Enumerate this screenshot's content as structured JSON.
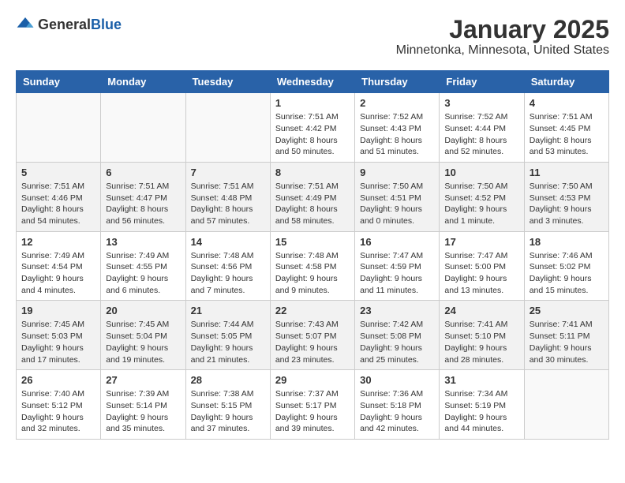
{
  "header": {
    "logo_general": "General",
    "logo_blue": "Blue",
    "month": "January 2025",
    "location": "Minnetonka, Minnesota, United States"
  },
  "days_of_week": [
    "Sunday",
    "Monday",
    "Tuesday",
    "Wednesday",
    "Thursday",
    "Friday",
    "Saturday"
  ],
  "weeks": [
    {
      "shade": false,
      "days": [
        {
          "num": "",
          "info": ""
        },
        {
          "num": "",
          "info": ""
        },
        {
          "num": "",
          "info": ""
        },
        {
          "num": "1",
          "info": "Sunrise: 7:51 AM\nSunset: 4:42 PM\nDaylight: 8 hours\nand 50 minutes."
        },
        {
          "num": "2",
          "info": "Sunrise: 7:52 AM\nSunset: 4:43 PM\nDaylight: 8 hours\nand 51 minutes."
        },
        {
          "num": "3",
          "info": "Sunrise: 7:52 AM\nSunset: 4:44 PM\nDaylight: 8 hours\nand 52 minutes."
        },
        {
          "num": "4",
          "info": "Sunrise: 7:51 AM\nSunset: 4:45 PM\nDaylight: 8 hours\nand 53 minutes."
        }
      ]
    },
    {
      "shade": true,
      "days": [
        {
          "num": "5",
          "info": "Sunrise: 7:51 AM\nSunset: 4:46 PM\nDaylight: 8 hours\nand 54 minutes."
        },
        {
          "num": "6",
          "info": "Sunrise: 7:51 AM\nSunset: 4:47 PM\nDaylight: 8 hours\nand 56 minutes."
        },
        {
          "num": "7",
          "info": "Sunrise: 7:51 AM\nSunset: 4:48 PM\nDaylight: 8 hours\nand 57 minutes."
        },
        {
          "num": "8",
          "info": "Sunrise: 7:51 AM\nSunset: 4:49 PM\nDaylight: 8 hours\nand 58 minutes."
        },
        {
          "num": "9",
          "info": "Sunrise: 7:50 AM\nSunset: 4:51 PM\nDaylight: 9 hours\nand 0 minutes."
        },
        {
          "num": "10",
          "info": "Sunrise: 7:50 AM\nSunset: 4:52 PM\nDaylight: 9 hours\nand 1 minute."
        },
        {
          "num": "11",
          "info": "Sunrise: 7:50 AM\nSunset: 4:53 PM\nDaylight: 9 hours\nand 3 minutes."
        }
      ]
    },
    {
      "shade": false,
      "days": [
        {
          "num": "12",
          "info": "Sunrise: 7:49 AM\nSunset: 4:54 PM\nDaylight: 9 hours\nand 4 minutes."
        },
        {
          "num": "13",
          "info": "Sunrise: 7:49 AM\nSunset: 4:55 PM\nDaylight: 9 hours\nand 6 minutes."
        },
        {
          "num": "14",
          "info": "Sunrise: 7:48 AM\nSunset: 4:56 PM\nDaylight: 9 hours\nand 7 minutes."
        },
        {
          "num": "15",
          "info": "Sunrise: 7:48 AM\nSunset: 4:58 PM\nDaylight: 9 hours\nand 9 minutes."
        },
        {
          "num": "16",
          "info": "Sunrise: 7:47 AM\nSunset: 4:59 PM\nDaylight: 9 hours\nand 11 minutes."
        },
        {
          "num": "17",
          "info": "Sunrise: 7:47 AM\nSunset: 5:00 PM\nDaylight: 9 hours\nand 13 minutes."
        },
        {
          "num": "18",
          "info": "Sunrise: 7:46 AM\nSunset: 5:02 PM\nDaylight: 9 hours\nand 15 minutes."
        }
      ]
    },
    {
      "shade": true,
      "days": [
        {
          "num": "19",
          "info": "Sunrise: 7:45 AM\nSunset: 5:03 PM\nDaylight: 9 hours\nand 17 minutes."
        },
        {
          "num": "20",
          "info": "Sunrise: 7:45 AM\nSunset: 5:04 PM\nDaylight: 9 hours\nand 19 minutes."
        },
        {
          "num": "21",
          "info": "Sunrise: 7:44 AM\nSunset: 5:05 PM\nDaylight: 9 hours\nand 21 minutes."
        },
        {
          "num": "22",
          "info": "Sunrise: 7:43 AM\nSunset: 5:07 PM\nDaylight: 9 hours\nand 23 minutes."
        },
        {
          "num": "23",
          "info": "Sunrise: 7:42 AM\nSunset: 5:08 PM\nDaylight: 9 hours\nand 25 minutes."
        },
        {
          "num": "24",
          "info": "Sunrise: 7:41 AM\nSunset: 5:10 PM\nDaylight: 9 hours\nand 28 minutes."
        },
        {
          "num": "25",
          "info": "Sunrise: 7:41 AM\nSunset: 5:11 PM\nDaylight: 9 hours\nand 30 minutes."
        }
      ]
    },
    {
      "shade": false,
      "days": [
        {
          "num": "26",
          "info": "Sunrise: 7:40 AM\nSunset: 5:12 PM\nDaylight: 9 hours\nand 32 minutes."
        },
        {
          "num": "27",
          "info": "Sunrise: 7:39 AM\nSunset: 5:14 PM\nDaylight: 9 hours\nand 35 minutes."
        },
        {
          "num": "28",
          "info": "Sunrise: 7:38 AM\nSunset: 5:15 PM\nDaylight: 9 hours\nand 37 minutes."
        },
        {
          "num": "29",
          "info": "Sunrise: 7:37 AM\nSunset: 5:17 PM\nDaylight: 9 hours\nand 39 minutes."
        },
        {
          "num": "30",
          "info": "Sunrise: 7:36 AM\nSunset: 5:18 PM\nDaylight: 9 hours\nand 42 minutes."
        },
        {
          "num": "31",
          "info": "Sunrise: 7:34 AM\nSunset: 5:19 PM\nDaylight: 9 hours\nand 44 minutes."
        },
        {
          "num": "",
          "info": ""
        }
      ]
    }
  ]
}
